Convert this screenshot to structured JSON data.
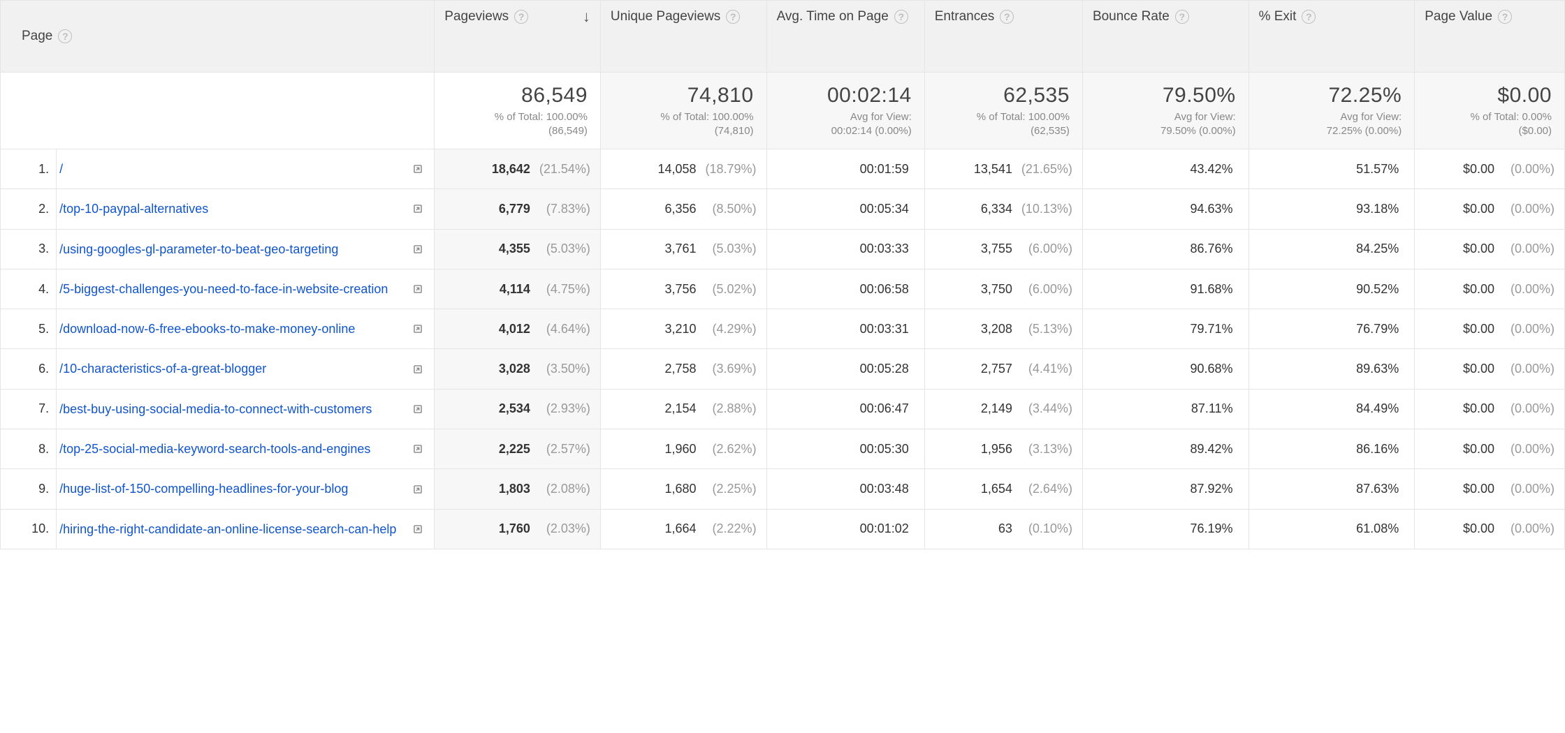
{
  "columns": {
    "page": "Page",
    "pageviews": "Pageviews",
    "unique_pageviews": "Unique Pageviews",
    "avg_time": "Avg. Time on Page",
    "entrances": "Entrances",
    "bounce_rate": "Bounce Rate",
    "pct_exit": "% Exit",
    "page_value": "Page Value"
  },
  "summary": {
    "pageviews": {
      "value": "86,549",
      "sub1": "% of Total: 100.00%",
      "sub2": "(86,549)"
    },
    "unique_pageviews": {
      "value": "74,810",
      "sub1": "% of Total: 100.00%",
      "sub2": "(74,810)"
    },
    "avg_time": {
      "value": "00:02:14",
      "sub1": "Avg for View:",
      "sub2": "00:02:14 (0.00%)"
    },
    "entrances": {
      "value": "62,535",
      "sub1": "% of Total: 100.00%",
      "sub2": "(62,535)"
    },
    "bounce_rate": {
      "value": "79.50%",
      "sub1": "Avg for View:",
      "sub2": "79.50% (0.00%)"
    },
    "pct_exit": {
      "value": "72.25%",
      "sub1": "Avg for View:",
      "sub2": "72.25% (0.00%)"
    },
    "page_value": {
      "value": "$0.00",
      "sub1": "% of Total: 0.00%",
      "sub2": "($0.00)"
    }
  },
  "rows": [
    {
      "idx": "1.",
      "path": "/",
      "pv": "18,642",
      "pv_pct": "(21.54%)",
      "upv": "14,058",
      "upv_pct": "(18.79%)",
      "time": "00:01:59",
      "ent": "13,541",
      "ent_pct": "(21.65%)",
      "br": "43.42%",
      "exit": "51.57%",
      "val": "$0.00",
      "val_pct": "(0.00%)"
    },
    {
      "idx": "2.",
      "path": "/top-10-paypal-alternatives",
      "pv": "6,779",
      "pv_pct": "(7.83%)",
      "upv": "6,356",
      "upv_pct": "(8.50%)",
      "time": "00:05:34",
      "ent": "6,334",
      "ent_pct": "(10.13%)",
      "br": "94.63%",
      "exit": "93.18%",
      "val": "$0.00",
      "val_pct": "(0.00%)"
    },
    {
      "idx": "3.",
      "path": "/using-googles-gl-parameter-to-beat-geo-targeting",
      "pv": "4,355",
      "pv_pct": "(5.03%)",
      "upv": "3,761",
      "upv_pct": "(5.03%)",
      "time": "00:03:33",
      "ent": "3,755",
      "ent_pct": "(6.00%)",
      "br": "86.76%",
      "exit": "84.25%",
      "val": "$0.00",
      "val_pct": "(0.00%)"
    },
    {
      "idx": "4.",
      "path": "/5-biggest-challenges-you-need-to-face-in-website-creation",
      "pv": "4,114",
      "pv_pct": "(4.75%)",
      "upv": "3,756",
      "upv_pct": "(5.02%)",
      "time": "00:06:58",
      "ent": "3,750",
      "ent_pct": "(6.00%)",
      "br": "91.68%",
      "exit": "90.52%",
      "val": "$0.00",
      "val_pct": "(0.00%)"
    },
    {
      "idx": "5.",
      "path": "/download-now-6-free-ebooks-to-make-money-online",
      "pv": "4,012",
      "pv_pct": "(4.64%)",
      "upv": "3,210",
      "upv_pct": "(4.29%)",
      "time": "00:03:31",
      "ent": "3,208",
      "ent_pct": "(5.13%)",
      "br": "79.71%",
      "exit": "76.79%",
      "val": "$0.00",
      "val_pct": "(0.00%)"
    },
    {
      "idx": "6.",
      "path": "/10-characteristics-of-a-great-blogger",
      "pv": "3,028",
      "pv_pct": "(3.50%)",
      "upv": "2,758",
      "upv_pct": "(3.69%)",
      "time": "00:05:28",
      "ent": "2,757",
      "ent_pct": "(4.41%)",
      "br": "90.68%",
      "exit": "89.63%",
      "val": "$0.00",
      "val_pct": "(0.00%)"
    },
    {
      "idx": "7.",
      "path": "/best-buy-using-social-media-to-connect-with-customers",
      "pv": "2,534",
      "pv_pct": "(2.93%)",
      "upv": "2,154",
      "upv_pct": "(2.88%)",
      "time": "00:06:47",
      "ent": "2,149",
      "ent_pct": "(3.44%)",
      "br": "87.11%",
      "exit": "84.49%",
      "val": "$0.00",
      "val_pct": "(0.00%)"
    },
    {
      "idx": "8.",
      "path": "/top-25-social-media-keyword-search-tools-and-engines",
      "pv": "2,225",
      "pv_pct": "(2.57%)",
      "upv": "1,960",
      "upv_pct": "(2.62%)",
      "time": "00:05:30",
      "ent": "1,956",
      "ent_pct": "(3.13%)",
      "br": "89.42%",
      "exit": "86.16%",
      "val": "$0.00",
      "val_pct": "(0.00%)"
    },
    {
      "idx": "9.",
      "path": "/huge-list-of-150-compelling-headlines-for-your-blog",
      "pv": "1,803",
      "pv_pct": "(2.08%)",
      "upv": "1,680",
      "upv_pct": "(2.25%)",
      "time": "00:03:48",
      "ent": "1,654",
      "ent_pct": "(2.64%)",
      "br": "87.92%",
      "exit": "87.63%",
      "val": "$0.00",
      "val_pct": "(0.00%)"
    },
    {
      "idx": "10.",
      "path": "/hiring-the-right-candidate-an-online-license-search-can-help",
      "pv": "1,760",
      "pv_pct": "(2.03%)",
      "upv": "1,664",
      "upv_pct": "(2.22%)",
      "time": "00:01:02",
      "ent": "63",
      "ent_pct": "(0.10%)",
      "br": "76.19%",
      "exit": "61.08%",
      "val": "$0.00",
      "val_pct": "(0.00%)"
    }
  ]
}
